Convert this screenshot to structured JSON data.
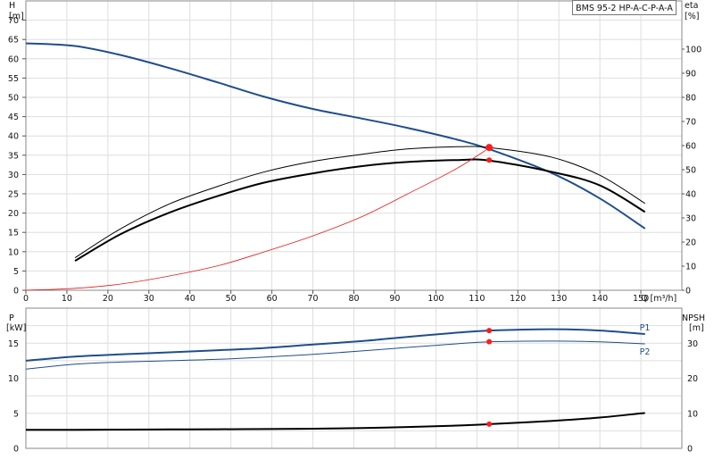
{
  "header": {
    "model": "BMS 95-2 HP-A-C-P-A-A"
  },
  "colors": {
    "head": "#1f4e8c",
    "efficiency": "#000000",
    "npsh": "#e31b1b",
    "power": "#1f4e8c",
    "duty_point": "#ff1a1a",
    "grid": "#dedede",
    "frame": "#888888"
  },
  "chart_data": [
    {
      "type": "line",
      "panel": "performance",
      "title": "",
      "xlabel": "Q [m³/h]",
      "ylabel_left": "H\n[m]",
      "ylabel_right": "eta\n[%]",
      "xlim": [
        0,
        160
      ],
      "ylim_left": [
        0,
        75
      ],
      "ylim_right": [
        0,
        120
      ],
      "x_ticks": [
        "0",
        "10",
        "20",
        "30",
        "40",
        "50",
        "60",
        "70",
        "80",
        "90",
        "100",
        "110",
        "120",
        "130",
        "140",
        "150"
      ],
      "y_ticks_left": [
        "0",
        "5",
        "10",
        "15",
        "20",
        "25",
        "30",
        "35",
        "40",
        "45",
        "50",
        "55",
        "60",
        "65",
        "70"
      ],
      "y_ticks_right": [
        "0",
        "10",
        "20",
        "30",
        "40",
        "50",
        "60",
        "70",
        "80",
        "90",
        "100"
      ],
      "grid": true,
      "series": [
        {
          "role": "head",
          "axis": "left",
          "x": [
            0,
            12,
            23,
            35,
            47,
            58,
            70,
            82,
            93,
            105,
            113,
            128,
            140,
            151
          ],
          "y": [
            64,
            63.3,
            61,
            57.6,
            53.8,
            50.2,
            47,
            44.5,
            42.1,
            39.1,
            36.6,
            30.5,
            23.8,
            16
          ]
        },
        {
          "role": "efficiency-upper",
          "axis": "right",
          "x": [
            12,
            23,
            35,
            47,
            58,
            70,
            82,
            93,
            105,
            113,
            128,
            140,
            151
          ],
          "y": [
            13.5,
            25.4,
            35.8,
            43.2,
            49,
            53.4,
            56.4,
            58.6,
            59.5,
            59.2,
            55.3,
            47.7,
            36
          ]
        },
        {
          "role": "efficiency",
          "axis": "right",
          "x": [
            12,
            23,
            35,
            47,
            58,
            70,
            82,
            93,
            105,
            113,
            128,
            140,
            151
          ],
          "y": [
            12.2,
            23.2,
            32.2,
            39.2,
            44.6,
            48.5,
            51.5,
            53.2,
            54,
            53.8,
            49.2,
            43.5,
            32.5
          ]
        },
        {
          "role": "npsh-curve",
          "axis": "left",
          "x": [
            0,
            12,
            23,
            35,
            47,
            58,
            70,
            82,
            93,
            105,
            113
          ],
          "y": [
            0,
            0.5,
            1.6,
            3.7,
            6.4,
            9.9,
            14.1,
            19.1,
            24.9,
            31.5,
            36.9
          ]
        }
      ],
      "duty_point": {
        "x": 113,
        "head": 37,
        "efficiency": 54
      }
    },
    {
      "type": "line",
      "panel": "power",
      "title": "",
      "xlabel": "",
      "ylabel_left": "P\n[kW]",
      "ylabel_right": "NPSH\n[m]",
      "xlim": [
        0,
        160
      ],
      "ylim_left": [
        0,
        20
      ],
      "ylim_right": [
        0,
        40
      ],
      "y_ticks_left": [
        "0",
        "5",
        "10",
        "15"
      ],
      "y_ticks_right": [
        "0",
        "10",
        "20",
        "30"
      ],
      "grid": true,
      "series": [
        {
          "name": "P1",
          "role": "p1",
          "axis": "left",
          "x": [
            0,
            12,
            23,
            35,
            47,
            58,
            70,
            82,
            93,
            105,
            113,
            128,
            140,
            151
          ],
          "y": [
            12.5,
            13.1,
            13.4,
            13.7,
            14,
            14.3,
            14.8,
            15.3,
            15.9,
            16.5,
            16.8,
            17,
            16.8,
            16.3
          ]
        },
        {
          "name": "P2",
          "role": "p2",
          "axis": "left",
          "x": [
            0,
            12,
            23,
            35,
            47,
            58,
            70,
            82,
            93,
            105,
            113,
            128,
            140,
            151
          ],
          "y": [
            11.3,
            12,
            12.3,
            12.5,
            12.7,
            13,
            13.4,
            13.9,
            14.4,
            14.9,
            15.2,
            15.3,
            15.2,
            14.9
          ]
        },
        {
          "role": "npsh",
          "axis": "right",
          "x": [
            0,
            12,
            23,
            35,
            47,
            58,
            70,
            82,
            93,
            105,
            113,
            128,
            140,
            151
          ],
          "y": [
            5.3,
            5.3,
            5.35,
            5.4,
            5.45,
            5.5,
            5.6,
            5.8,
            6.1,
            6.5,
            6.9,
            7.8,
            8.8,
            10.1
          ]
        }
      ],
      "duty_point": {
        "x": 113,
        "p1": 16.8,
        "p2": 15.2,
        "npsh": 6.9
      }
    }
  ]
}
